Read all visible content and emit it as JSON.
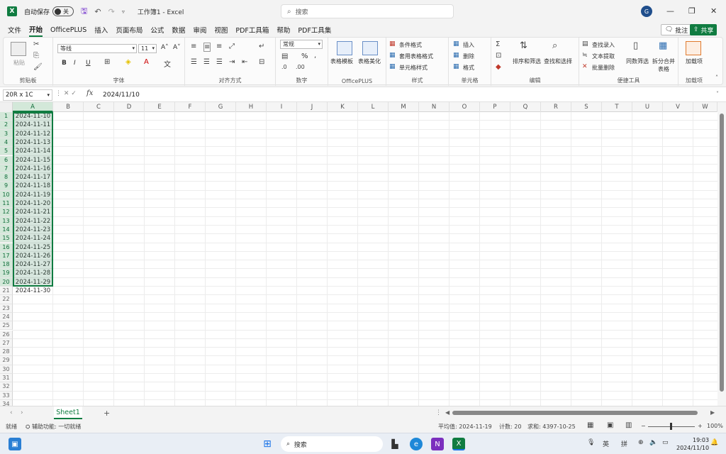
{
  "titlebar": {
    "autosave_label": "自动保存",
    "autosave_state": "关",
    "doc_title": "工作簿1 - Excel",
    "search_placeholder": "搜索",
    "avatar_initial": "G",
    "minimize": "—",
    "restore": "❐",
    "close": "✕"
  },
  "menu": {
    "items": [
      "文件",
      "开始",
      "OfficePLUS",
      "插入",
      "页面布局",
      "公式",
      "数据",
      "审阅",
      "视图",
      "PDF工具箱",
      "帮助",
      "PDF工具集"
    ],
    "active_index": 1,
    "comment_label": "批注",
    "share_label": "共享"
  },
  "ribbon": {
    "clipboard": {
      "paste": "粘贴",
      "label": "剪贴板"
    },
    "font": {
      "name": "等线",
      "size": "11",
      "label": "字体",
      "bold": "B",
      "italic": "I",
      "underline": "U",
      "grow": "A˄",
      "shrink": "A˅"
    },
    "align": {
      "label": "对齐方式"
    },
    "number": {
      "format": "常规",
      "label": "数字",
      "percent": "%"
    },
    "officeplus": {
      "template": "表格模板",
      "beautify": "表格美化",
      "label": "OfficePLUS"
    },
    "styles": {
      "conditional": "条件格式",
      "table_format": "套用表格格式",
      "cell_styles": "单元格样式",
      "label": "样式"
    },
    "cells": {
      "insert": "插入",
      "delete": "删除",
      "format": "格式",
      "label": "单元格"
    },
    "editing": {
      "sort": "排序和筛选",
      "find": "查找和选择",
      "label": "编辑"
    },
    "convenience": {
      "find_input": "查找录入",
      "text_extract": "文本提取",
      "batch_remove": "批量删除",
      "same_value": "同数筛选",
      "split_merge": "拆分合并表格",
      "label": "便捷工具"
    },
    "addins": {
      "add": "加载项",
      "label": "加载项"
    }
  },
  "formulabar": {
    "namebox": "20R x 1C",
    "formula": "2024/11/10"
  },
  "grid": {
    "columns": [
      "A",
      "B",
      "C",
      "D",
      "E",
      "F",
      "G",
      "H",
      "I",
      "J",
      "K",
      "L",
      "M",
      "N",
      "O",
      "P",
      "Q",
      "R",
      "S",
      "T",
      "U",
      "V",
      "W"
    ],
    "rows": [
      "1",
      "2",
      "3",
      "4",
      "5",
      "6",
      "7",
      "8",
      "9",
      "10",
      "11",
      "12",
      "13",
      "14",
      "15",
      "16",
      "17",
      "18",
      "19",
      "20",
      "21",
      "22",
      "23",
      "24",
      "25",
      "26",
      "27",
      "28",
      "29",
      "30",
      "31",
      "32",
      "33",
      "34"
    ],
    "colA": [
      "2024-11-10",
      "2024-11-11",
      "2024-11-12",
      "2024-11-13",
      "2024-11-14",
      "2024-11-15",
      "2024-11-16",
      "2024-11-17",
      "2024-11-18",
      "2024-11-19",
      "2024-11-20",
      "2024-11-21",
      "2024-11-22",
      "2024-11-23",
      "2024-11-24",
      "2024-11-25",
      "2024-11-26",
      "2024-11-27",
      "2024-11-28",
      "2024-11-29",
      "2024-11-30"
    ],
    "selected_rows": 20
  },
  "sheets": {
    "tabs": [
      "Sheet1"
    ],
    "add": "+"
  },
  "statusbar": {
    "ready": "就绪",
    "accessibility": "辅助功能: 一切就绪",
    "average": "平均值: 2024-11-19",
    "count": "计数: 20",
    "sum": "求和: 4397-10-25",
    "zoom": "100%"
  },
  "taskbar": {
    "search": "搜索",
    "lang": "英",
    "ime": "拼",
    "time": "19:03",
    "date": "2024/11/10"
  },
  "colors": {
    "excel_green": "#107c41",
    "selection_fill": "#d3e8d9"
  }
}
